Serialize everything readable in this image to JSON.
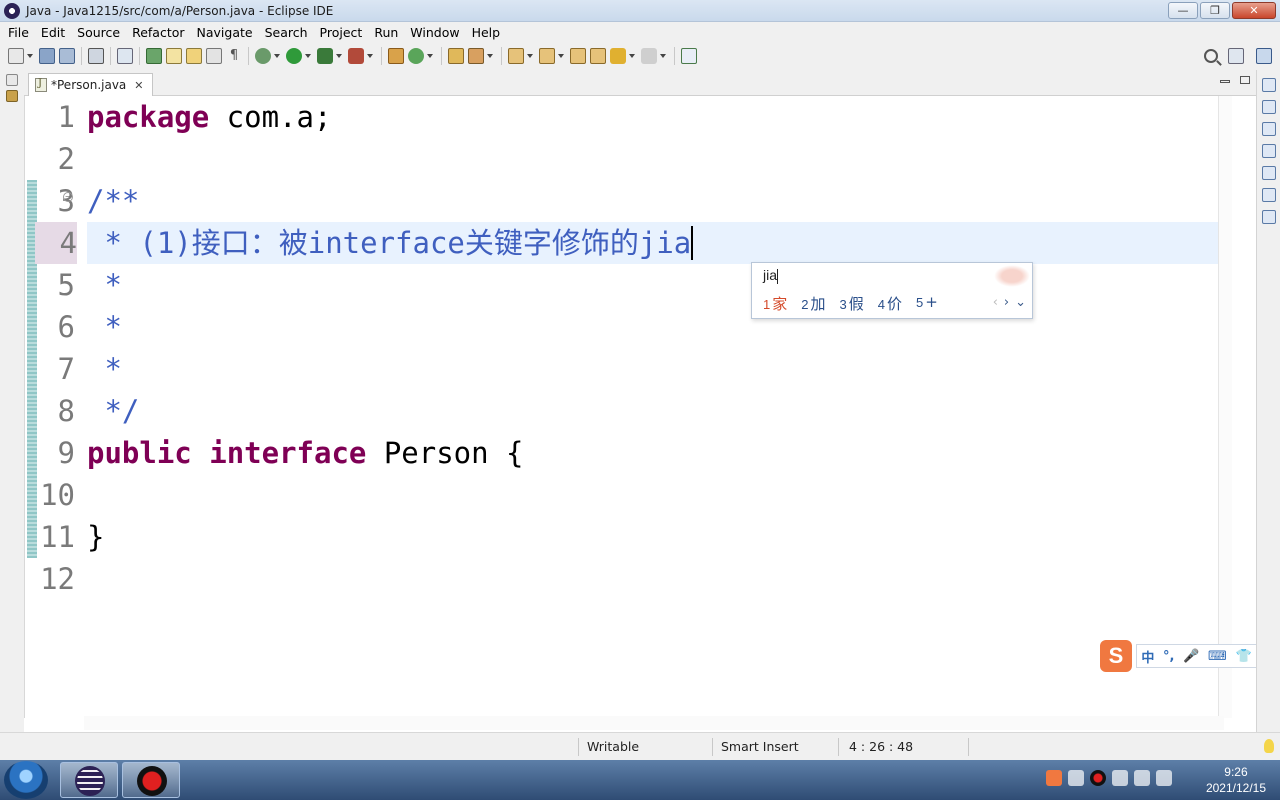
{
  "window": {
    "title": "Java - Java1215/src/com/a/Person.java - Eclipse IDE",
    "minimize": "—",
    "maximize": "❐",
    "close": "✕"
  },
  "menu": [
    "File",
    "Edit",
    "Source",
    "Refactor",
    "Navigate",
    "Search",
    "Project",
    "Run",
    "Window",
    "Help"
  ],
  "editor_tab": {
    "label": "*Person.java",
    "close": "✕"
  },
  "editor": {
    "current_line": 4,
    "lines": [
      {
        "n": "1",
        "tokens": [
          {
            "t": "package",
            "c": "kw"
          },
          {
            "t": " com.a;",
            "c": "plain"
          }
        ]
      },
      {
        "n": "2",
        "tokens": []
      },
      {
        "n": "3",
        "tokens": [
          {
            "t": "/**",
            "c": "comment"
          }
        ]
      },
      {
        "n": "4",
        "tokens": [
          {
            "t": " * (1)接口：被interface关键字修饰的jia",
            "c": "comment"
          }
        ]
      },
      {
        "n": "5",
        "tokens": [
          {
            "t": " *",
            "c": "comment"
          }
        ]
      },
      {
        "n": "6",
        "tokens": [
          {
            "t": " *",
            "c": "comment"
          }
        ]
      },
      {
        "n": "7",
        "tokens": [
          {
            "t": " *",
            "c": "comment"
          }
        ]
      },
      {
        "n": "8",
        "tokens": [
          {
            "t": " */",
            "c": "comment"
          }
        ]
      },
      {
        "n": "9",
        "tokens": [
          {
            "t": "public",
            "c": "kw"
          },
          {
            "t": " ",
            "c": "plain"
          },
          {
            "t": "interface",
            "c": "kw"
          },
          {
            "t": " Person {",
            "c": "plain"
          }
        ]
      },
      {
        "n": "10",
        "tokens": []
      },
      {
        "n": "11",
        "tokens": [
          {
            "t": "}",
            "c": "plain"
          }
        ]
      },
      {
        "n": "12",
        "tokens": []
      }
    ]
  },
  "ime_popup": {
    "input": "jia",
    "candidates": [
      {
        "num": "1",
        "text": "家"
      },
      {
        "num": "2",
        "text": "加"
      },
      {
        "num": "3",
        "text": "假"
      },
      {
        "num": "4",
        "text": "价"
      },
      {
        "num": "5",
        "text": "+"
      }
    ],
    "nav": {
      "prev": "‹",
      "next": "›",
      "expand": "⌄"
    }
  },
  "sogou_bar": {
    "logo": "S",
    "mode": "中",
    "punct": "°,",
    "mic": "🎤",
    "keyboard": "⌨",
    "skin": "👕",
    "tools": "▦"
  },
  "status": {
    "writable": "Writable",
    "insert_mode": "Smart Insert",
    "position": "4 : 26 : 48"
  },
  "taskbar": {
    "time": "9:26",
    "date": "2021/12/15"
  }
}
